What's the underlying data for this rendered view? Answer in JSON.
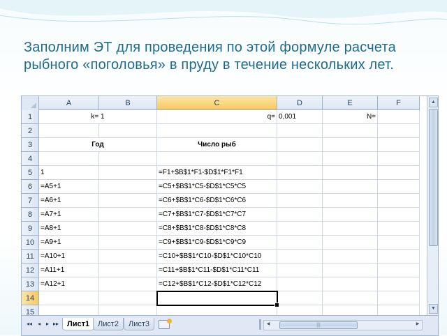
{
  "slide": {
    "title": "Заполним ЭТ для проведения по этой формуле расчета рыбного «поголовья» в пруду в течение нескольких лет."
  },
  "sheet": {
    "columns": [
      "A",
      "B",
      "C",
      "D",
      "E",
      "F"
    ],
    "selected_column": "C",
    "rows": [
      "1",
      "2",
      "3",
      "4",
      "5",
      "6",
      "7",
      "8",
      "9",
      "10",
      "11",
      "12",
      "13",
      "14",
      "15"
    ],
    "selected_row": "14",
    "cells": {
      "B1": "k= 1",
      "C1": "q=",
      "D1": "0,001",
      "E1": "N=",
      "A3": "Год",
      "C3": "Число рыб",
      "A5": "1",
      "C5": "=F1+$B$1*F1-$D$1*F1*F1",
      "A6": "=A5+1",
      "C6": "=C5+$B$1*C5-$D$1*C5*C5",
      "A7": "=A6+1",
      "C7": "=C6+$B$1*C6-$D$1*C6*C6",
      "A8": "=A7+1",
      "C8": "=C7+$B$1*C7-$D$1*C7*C7",
      "A9": "=A8+1",
      "C9": "=C8+$B$1*C8-$D$1*C8*C8",
      "A10": "=A9+1",
      "C10": "=C9+$B$1*C9-$D$1*C9*C9",
      "A11": "=A10+1",
      "C11": "=C10+$B$1*C10-$D$1*C10*C10",
      "A12": "=A11+1",
      "C12": "=C11+$B$1*C11-$D$1*C11*C11",
      "A13": "=A12+1",
      "C13": "=C12+$B$1*C12-$D$1*C12*C12"
    },
    "active_cell": "C14"
  },
  "tabs": [
    "Лист1",
    "Лист2",
    "Лист3"
  ],
  "active_tab": "Лист1",
  "nav_buttons": [
    "first-sheet",
    "prev-sheet",
    "next-sheet",
    "last-sheet"
  ],
  "nav_glyphs": [
    "◂◂",
    "◂",
    "▸",
    "▸▸"
  ],
  "colors": {
    "title": "#1f6b8e",
    "header_bg": "#dce6f3",
    "selected_header": "#f8c960"
  }
}
